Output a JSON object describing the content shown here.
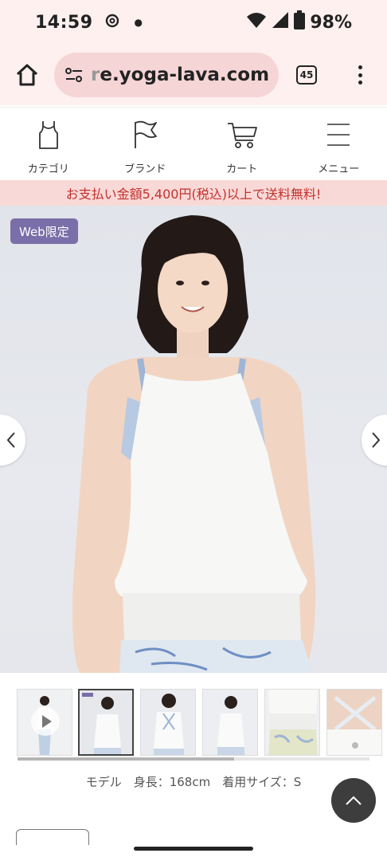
{
  "status_bar": {
    "time": "14:59",
    "battery": "98%"
  },
  "browser": {
    "url_faded": "r",
    "url": "e.yoga-lava.com",
    "tab_count": "45"
  },
  "site_nav": [
    {
      "label": "カテゴリ",
      "icon": "tank-top-icon"
    },
    {
      "label": "ブランド",
      "icon": "flag-icon"
    },
    {
      "label": "カート",
      "icon": "cart-icon"
    },
    {
      "label": "メニュー",
      "icon": "hamburger-menu-icon"
    }
  ],
  "banner": "お支払い金額5,400円(税込)以上で送料無料!",
  "product": {
    "badge": "Web限定",
    "model_info": "モデル　身長：168cm　着用サイズ：S"
  },
  "thumbnails": [
    {
      "name": "video"
    },
    {
      "name": "front-badge",
      "selected": true
    },
    {
      "name": "back"
    },
    {
      "name": "front-2"
    },
    {
      "name": "side-detail"
    },
    {
      "name": "back-detail"
    }
  ],
  "colors": {
    "browser_bar": "#fdf0ef",
    "url_pill": "#f6d5d6",
    "banner_bg": "#f9d9d7",
    "banner_text": "#c3312d",
    "badge": "#7a6fa8"
  }
}
